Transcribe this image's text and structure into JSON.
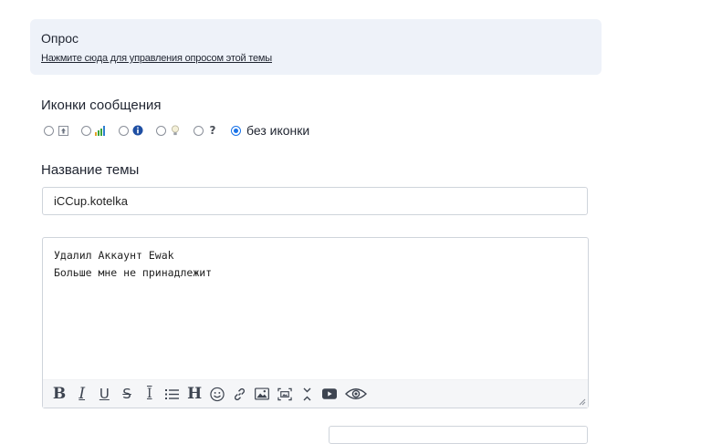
{
  "poll": {
    "title": "Опрос",
    "manage_link": "Нажмите сюда для управления опросом этой темы"
  },
  "message_icons": {
    "label": "Иконки сообщения",
    "options": [
      {
        "icon": "arrow-up-box-icon",
        "selected": false
      },
      {
        "icon": "bar-chart-icon",
        "selected": false
      },
      {
        "icon": "info-icon",
        "selected": false
      },
      {
        "icon": "lightbulb-icon",
        "selected": false
      },
      {
        "icon": "question-icon",
        "selected": false
      }
    ],
    "none_label": "без иконки",
    "none_selected": true,
    "colors": {
      "radio_accent": "#1a73e8",
      "chart_green": "#3aa53a",
      "info_blue": "#1f4fa3"
    }
  },
  "topic_title": {
    "label": "Название темы",
    "value": "iCCup.kotelka"
  },
  "editor": {
    "text": "Удалил Аккаунт Ewak\nБольше мне не принадлежит",
    "toolbar": [
      {
        "name": "bold-button",
        "glyph": "B",
        "icon": "bold-icon"
      },
      {
        "name": "italic-button",
        "glyph": "I",
        "icon": "italic-icon"
      },
      {
        "name": "underline-button",
        "glyph": "U",
        "icon": "underline-icon"
      },
      {
        "name": "strikethrough-button",
        "glyph": "S",
        "icon": "strikethrough-icon"
      },
      {
        "name": "text-cursor-button",
        "glyph": "I",
        "icon": "text-cursor-icon"
      },
      {
        "name": "list-button",
        "glyph": "",
        "icon": "list-icon"
      },
      {
        "name": "heading-button",
        "glyph": "H",
        "icon": "heading-icon"
      },
      {
        "name": "emoji-button",
        "glyph": "☺",
        "icon": "smiley-icon"
      },
      {
        "name": "link-button",
        "glyph": "",
        "icon": "link-icon"
      },
      {
        "name": "image-button",
        "glyph": "",
        "icon": "image-icon"
      },
      {
        "name": "screenshot-button",
        "glyph": "",
        "icon": "screenshot-icon"
      },
      {
        "name": "spoiler-button",
        "glyph": "",
        "icon": "collapse-icon"
      },
      {
        "name": "video-button",
        "glyph": "",
        "icon": "video-icon"
      },
      {
        "name": "preview-button",
        "glyph": "",
        "icon": "eye-icon"
      }
    ]
  }
}
